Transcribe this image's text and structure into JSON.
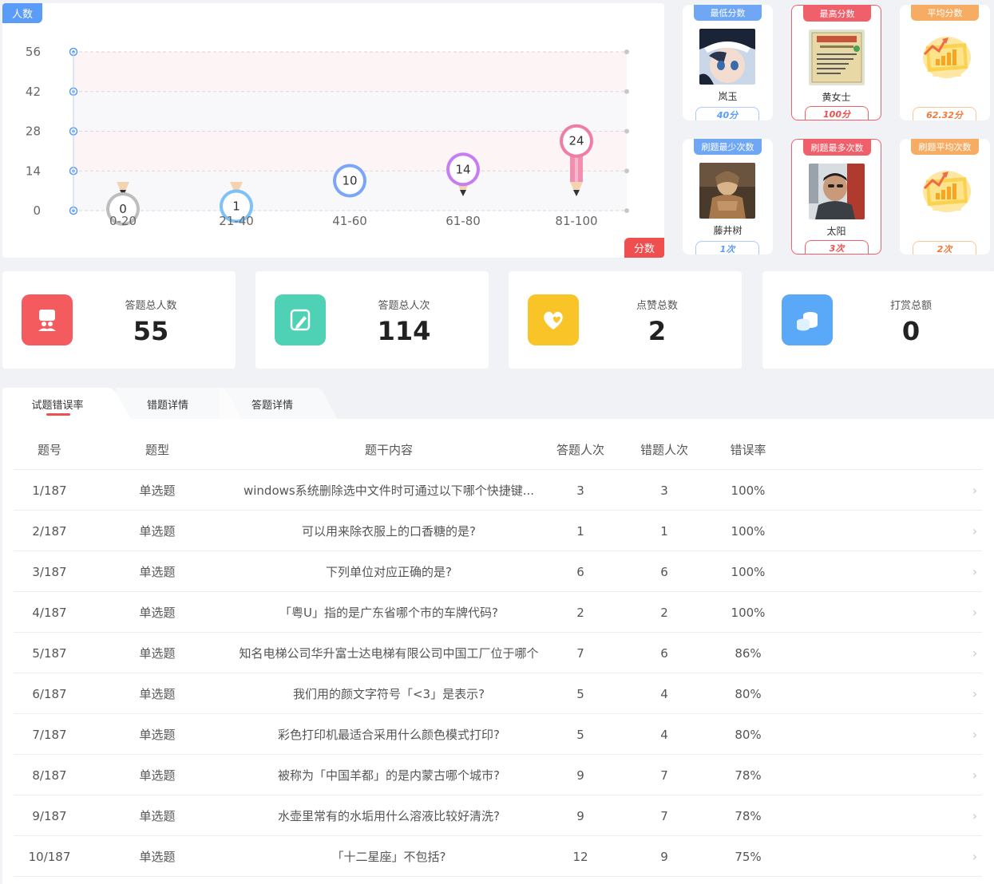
{
  "chart": {
    "y_tag": "人数",
    "x_tag": "分数"
  },
  "chart_data": {
    "type": "bar",
    "categories": [
      "0-20",
      "21-40",
      "41-60",
      "61-80",
      "81-100"
    ],
    "values": [
      0,
      1,
      10,
      14,
      24
    ],
    "yticks": [
      0,
      14,
      28,
      42,
      56
    ],
    "ylim": [
      0,
      56
    ],
    "xlabel": "分数",
    "ylabel": "人数",
    "colors": [
      "#bdbdbd",
      "#7cc1f7",
      "#7aa6f7",
      "#c77df2",
      "#f07da5"
    ]
  },
  "stats": [
    {
      "head": "最低分数",
      "name": "岚玉",
      "value": "40分",
      "theme": "blue",
      "avatar": "avatar-anime"
    },
    {
      "head": "最高分数",
      "name": "黄女士",
      "value": "100分",
      "theme": "red",
      "avatar": "avatar-sign"
    },
    {
      "head": "平均分数",
      "name": "",
      "value": "62.32分",
      "theme": "orange",
      "avatar": "chart-icon"
    },
    {
      "head": "刷题最少次数",
      "name": "藤井树",
      "value": "1次",
      "theme": "blue",
      "avatar": "avatar-warrior"
    },
    {
      "head": "刷题最多次数",
      "name": "太阳",
      "value": "3次",
      "theme": "red",
      "avatar": "avatar-man"
    },
    {
      "head": "刷题平均次数",
      "name": "",
      "value": "2次",
      "theme": "orange",
      "avatar": "chart-icon"
    }
  ],
  "summary": [
    {
      "label": "答题总人数",
      "value": "55",
      "icon": "users-icon",
      "color": "#f45b5f"
    },
    {
      "label": "答题总人次",
      "value": "114",
      "icon": "edit-icon",
      "color": "#4fd1b5"
    },
    {
      "label": "点赞总数",
      "value": "2",
      "icon": "heart-icon",
      "color": "#f9c428"
    },
    {
      "label": "打赏总额",
      "value": "0",
      "icon": "coins-icon",
      "color": "#5aa8f8"
    }
  ],
  "tabs": [
    "试题错误率",
    "错题详情",
    "答题详情"
  ],
  "table": {
    "headers": [
      "题号",
      "题型",
      "题干内容",
      "答题人次",
      "错题人次",
      "错误率"
    ],
    "rows": [
      [
        "1/187",
        "单选题",
        "windows系统删除选中文件时可通过以下哪个快捷键...",
        "3",
        "3",
        "100%"
      ],
      [
        "2/187",
        "单选题",
        "可以用来除衣服上的口香糖的是?",
        "1",
        "1",
        "100%"
      ],
      [
        "3/187",
        "单选题",
        "下列单位对应正确的是?",
        "6",
        "6",
        "100%"
      ],
      [
        "4/187",
        "单选题",
        "「粤U」指的是广东省哪个市的车牌代码?",
        "2",
        "2",
        "100%"
      ],
      [
        "5/187",
        "单选题",
        "知名电梯公司华升富士达电梯有限公司中国工厂位于哪个",
        "7",
        "6",
        "86%"
      ],
      [
        "6/187",
        "单选题",
        "我们用的颜文字符号「<3」是表示?",
        "5",
        "4",
        "80%"
      ],
      [
        "7/187",
        "单选题",
        "彩色打印机最适合采用什么颜色模式打印?",
        "5",
        "4",
        "80%"
      ],
      [
        "8/187",
        "单选题",
        "被称为「中国羊都」的是内蒙古哪个城市?",
        "9",
        "7",
        "78%"
      ],
      [
        "9/187",
        "单选题",
        "水壶里常有的水垢用什么溶液比较好清洗?",
        "9",
        "7",
        "78%"
      ],
      [
        "10/187",
        "单选题",
        "「十二星座」不包括?",
        "12",
        "9",
        "75%"
      ]
    ]
  }
}
